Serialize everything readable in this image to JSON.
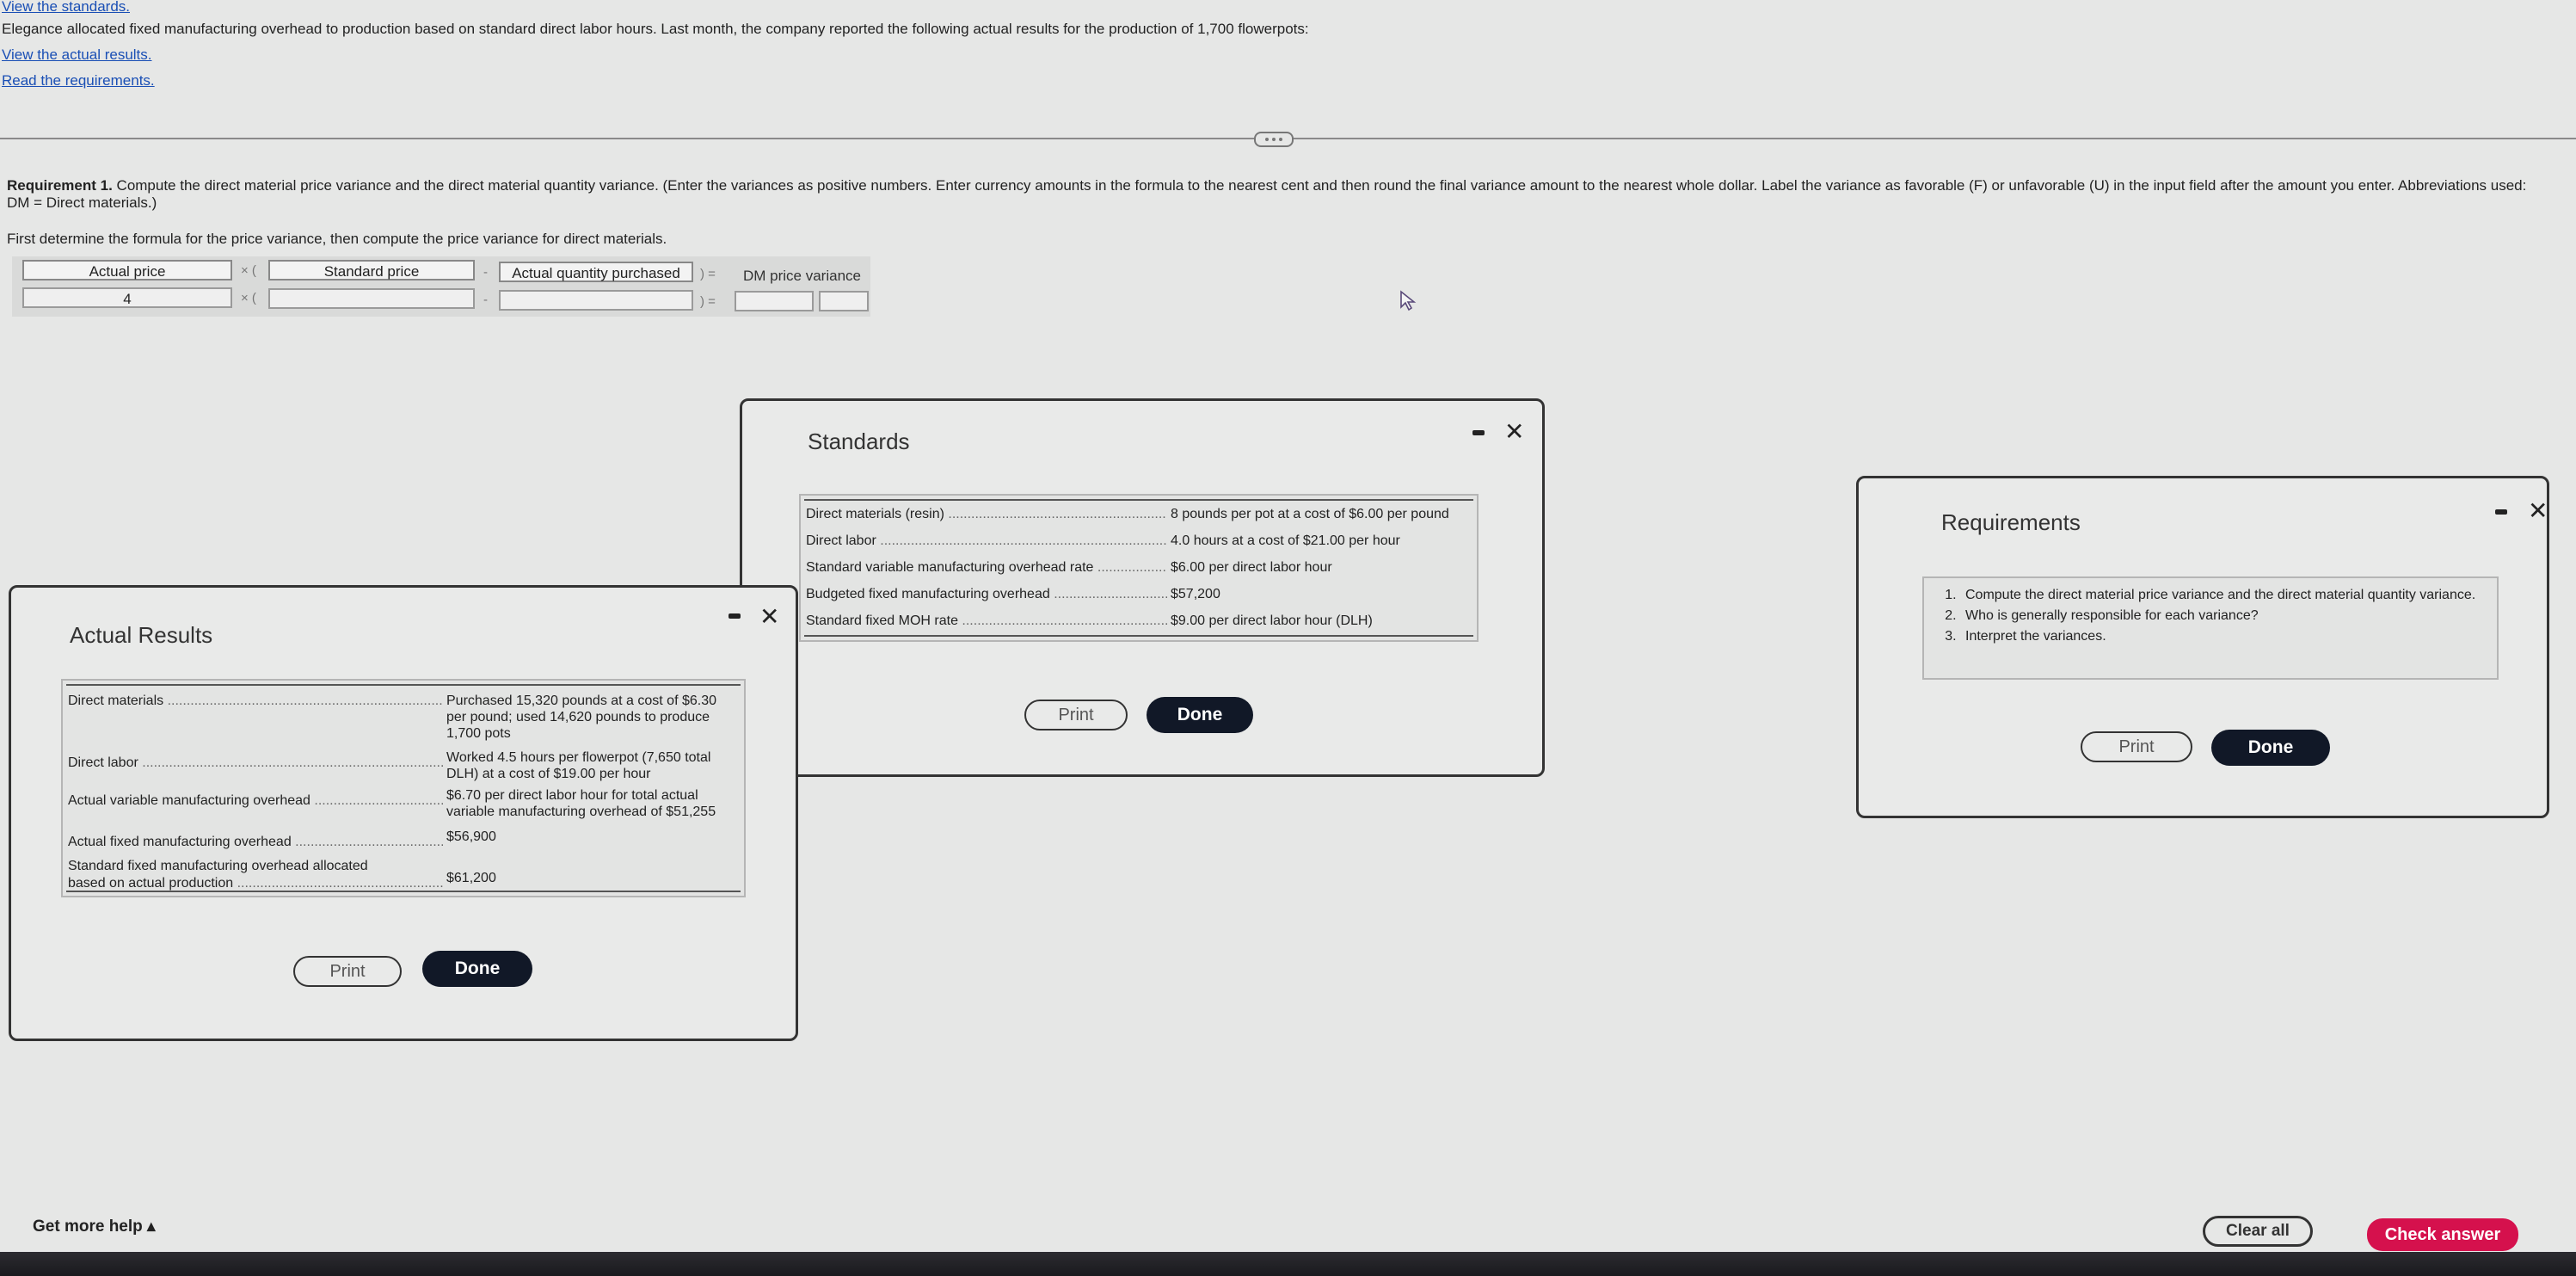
{
  "links": {
    "view_standards": "View the standards.",
    "view_actual": "View the actual results.",
    "read_requirements": "Read the requirements."
  },
  "intro_text": "Elegance allocated fixed manufacturing overhead to production based on standard direct labor hours. Last month, the company reported the following actual results for the production of 1,700 flowerpots:",
  "requirement": {
    "bold": "Requirement 1.",
    "text": " Compute the direct material price variance and the direct material quantity variance. (Enter the variances as positive numbers. Enter currency amounts in the formula to the nearest cent and then round the final variance amount to the nearest whole dollar. Label the variance as favorable (F) or unfavorable (U) in the input field after the amount you enter. Abbreviations used:",
    "line2": "DM = Direct materials.)",
    "instruction": "First determine the formula for the price variance, then compute the price variance for direct materials."
  },
  "formula": {
    "headers": {
      "actual_price": "Actual price",
      "standard_price": "Standard price",
      "actual_qty": "Actual quantity purchased",
      "result": "DM price variance"
    },
    "ops": {
      "times": "× (",
      "minus": "-",
      "close_eq": ") ="
    },
    "values": {
      "actual_price": "4",
      "standard_price": "",
      "actual_qty": "",
      "variance_amount": "",
      "variance_label": ""
    }
  },
  "standards_dialog": {
    "title": "Standards",
    "rows": [
      {
        "label": "Direct materials (resin)",
        "value": "8 pounds per pot at a cost of $6.00 per pound"
      },
      {
        "label": "Direct labor",
        "value": "4.0 hours at a cost of $21.00 per hour"
      },
      {
        "label": "Standard variable manufacturing overhead rate",
        "value": "$6.00 per direct labor hour"
      },
      {
        "label": "Budgeted fixed manufacturing overhead",
        "value": "$57,200"
      },
      {
        "label": "Standard fixed MOH rate",
        "value": "$9.00 per direct labor hour (DLH)"
      }
    ],
    "print": "Print",
    "done": "Done"
  },
  "actual_dialog": {
    "title": "Actual Results",
    "rows": [
      {
        "label": "Direct materials",
        "value": "Purchased 15,320 pounds at a cost of $6.30 per pound; used 14,620 pounds to produce 1,700 pots"
      },
      {
        "label": "Direct labor",
        "value": "Worked 4.5 hours per flowerpot (7,650 total DLH) at a cost of $19.00 per hour"
      },
      {
        "label": "Actual variable manufacturing overhead",
        "value": "$6.70 per direct labor hour for total actual variable manufacturing overhead of $51,255"
      },
      {
        "label": "Actual fixed manufacturing overhead",
        "value": "$56,900"
      },
      {
        "label_line1": "Standard fixed manufacturing overhead allocated",
        "label": "based on actual production",
        "value": "$61,200"
      }
    ],
    "print": "Print",
    "done": "Done"
  },
  "requirements_dialog": {
    "title": "Requirements",
    "items": [
      "Compute the direct material price variance and the direct material quantity variance.",
      "Who is generally responsible for each variance?",
      "Interpret the variances."
    ],
    "print": "Print",
    "done": "Done"
  },
  "footer": {
    "help": "Get more help ▴",
    "clear": "Clear all",
    "check": "Check answer"
  },
  "colors": {
    "link": "#1a4fb5",
    "check_answer": "#d5114d",
    "done_button": "#111827"
  }
}
